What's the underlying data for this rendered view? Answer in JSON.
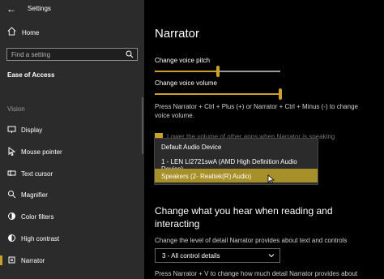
{
  "sidebar": {
    "app_title": "Settings",
    "home_label": "Home",
    "search_placeholder": "Find a setting",
    "section": "Ease of Access",
    "group": "Vision",
    "items": [
      {
        "label": "Display",
        "icon": "display-icon"
      },
      {
        "label": "Mouse pointer",
        "icon": "mouse-pointer-icon"
      },
      {
        "label": "Text cursor",
        "icon": "text-cursor-icon"
      },
      {
        "label": "Magnifier",
        "icon": "magnifier-icon"
      },
      {
        "label": "Color filters",
        "icon": "color-filters-icon"
      },
      {
        "label": "High contrast",
        "icon": "high-contrast-icon"
      },
      {
        "label": "Narrator",
        "icon": "narrator-icon",
        "selected": true
      }
    ]
  },
  "main": {
    "title": "Narrator",
    "pitch_label": "Change voice pitch",
    "pitch_value": 0.5,
    "volume_label": "Change voice volume",
    "volume_value": 1.0,
    "description": "Press Narrator + Ctrl + Plus (+) or Narrator + Ctrl + Minus (-) to change voice volume.",
    "checkbox_text": "Lower the volume of other apps when Narrator is speaking",
    "dropdown": {
      "options": [
        "Default Audio Device",
        "1 - LEN LI2721swA (AMD High Definition Audio Device)",
        "Speakers (2- Realtek(R) Audio)"
      ],
      "selected_index": 2
    },
    "section_heading": "Change what you hear when reading and interacting",
    "detail_label": "Change the level of detail Narrator provides about text and controls",
    "detail_value": "3 - All control details",
    "bottom_text": "Press Narrator + V to change how much detail Narrator provides about"
  },
  "colors": {
    "accent": "#c9a227",
    "sidebar_bg": "#2b2b2b",
    "main_bg": "#000000"
  }
}
